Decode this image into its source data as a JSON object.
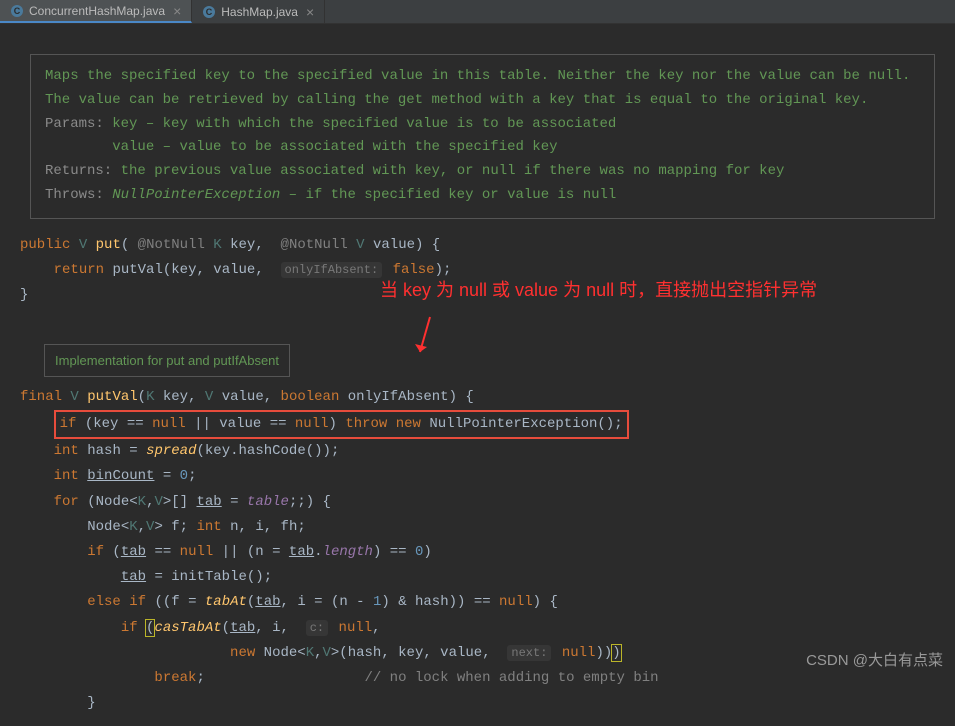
{
  "tabs": [
    {
      "icon": "C",
      "label": "ConcurrentHashMap.java",
      "active": true
    },
    {
      "icon": "C",
      "label": "HashMap.java",
      "active": false
    }
  ],
  "doc": {
    "line1": "Maps the specified key to the specified value in this table. Neither the key nor the value can be null.",
    "line2_before": "The value can be retrieved by calling the ",
    "line2_code": "get",
    "line2_after": " method with a key that is equal to the original key.",
    "params_label": "Params:",
    "param1_name": "key",
    "param1_desc": " – key with which the specified value is to be associated",
    "param2_name": "value",
    "param2_desc": " – value to be associated with the specified key",
    "returns_label": "Returns:",
    "returns_before": " the previous value associated with ",
    "returns_code1": "key",
    "returns_mid": ", or ",
    "returns_code2": "null",
    "returns_after": " if there was no mapping for ",
    "returns_code3": "key",
    "throws_label": "Throws:",
    "throws_code": "NullPointerException",
    "throws_desc": " – if the specified key or value is null"
  },
  "impl_label": "Implementation for put and putIfAbsent",
  "annotation": "当 key 为 null 或 value 为 null 时，直接抛出空指针异常",
  "watermark": "CSDN @大白有点菜",
  "code": {
    "public": "public",
    "V": "V",
    "put": "put",
    "notnull": "@NotNull",
    "K": "K",
    "key": "key",
    "value": "value",
    "return": "return",
    "putVal": "putVal",
    "onlyIfAbsent_hint": "onlyIfAbsent:",
    "false": "false",
    "final": "final",
    "boolean": "boolean",
    "onlyIfAbsent": "onlyIfAbsent",
    "if": "if",
    "null": "null",
    "throw": "throw",
    "new": "new",
    "NullPointerException": "NullPointerException",
    "int": "int",
    "hash": "hash",
    "spread": "spread",
    "hashCode": "hashCode",
    "binCount": "binCount",
    "zero": "0",
    "for": "for",
    "Node": "Node",
    "tab": "tab",
    "table": "table",
    "f": "f",
    "n": "n",
    "i": "i",
    "fh": "fh",
    "length": "length",
    "initTable": "initTable",
    "else": "else",
    "tabAt": "tabAt",
    "one": "1",
    "casTabAt": "casTabAt",
    "c_hint": "c:",
    "next_hint": "next:",
    "break": "break",
    "comment_empty": "// no lock when adding to empty bin"
  }
}
